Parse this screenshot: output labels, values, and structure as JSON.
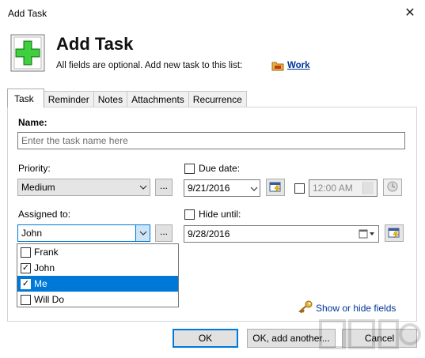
{
  "window": {
    "title": "Add Task",
    "close_glyph": "✕"
  },
  "header": {
    "title": "Add Task",
    "subtitle": "All fields are optional. Add new task to this list:",
    "list_name": "Work"
  },
  "tabs": [
    {
      "label": "Task",
      "active": true
    },
    {
      "label": "Reminder",
      "active": false
    },
    {
      "label": "Notes",
      "active": false
    },
    {
      "label": "Attachments",
      "active": false
    },
    {
      "label": "Recurrence",
      "active": false
    }
  ],
  "form": {
    "name_label": "Name:",
    "name_placeholder": "Enter the task name here",
    "priority_label": "Priority:",
    "priority_value": "Medium",
    "ellipsis": "...",
    "due_label": "Due date:",
    "due_value": "9/21/2016",
    "due_time": "12:00 AM",
    "assigned_label": "Assigned to:",
    "assigned_value": "John",
    "hide_label": "Hide until:",
    "hide_value": "9/28/2016"
  },
  "assignees": [
    {
      "name": "Frank",
      "checked": false,
      "selected": false
    },
    {
      "name": "John",
      "checked": true,
      "selected": false
    },
    {
      "name": "Me",
      "checked": true,
      "selected": true
    },
    {
      "name": "Will Do",
      "checked": false,
      "selected": false
    }
  ],
  "show_hide": "Show or hide fields",
  "buttons": {
    "ok": "OK",
    "ok_add": "OK, add another...",
    "cancel": "Cancel"
  },
  "colors": {
    "accent": "#0078d7",
    "link": "#003399",
    "plus_green": "#2fb52f"
  },
  "icons": [
    "add-task-icon",
    "folder-icon",
    "calendar-icon",
    "clock-icon",
    "key-icon",
    "close-icon",
    "chevron-down-icon"
  ]
}
